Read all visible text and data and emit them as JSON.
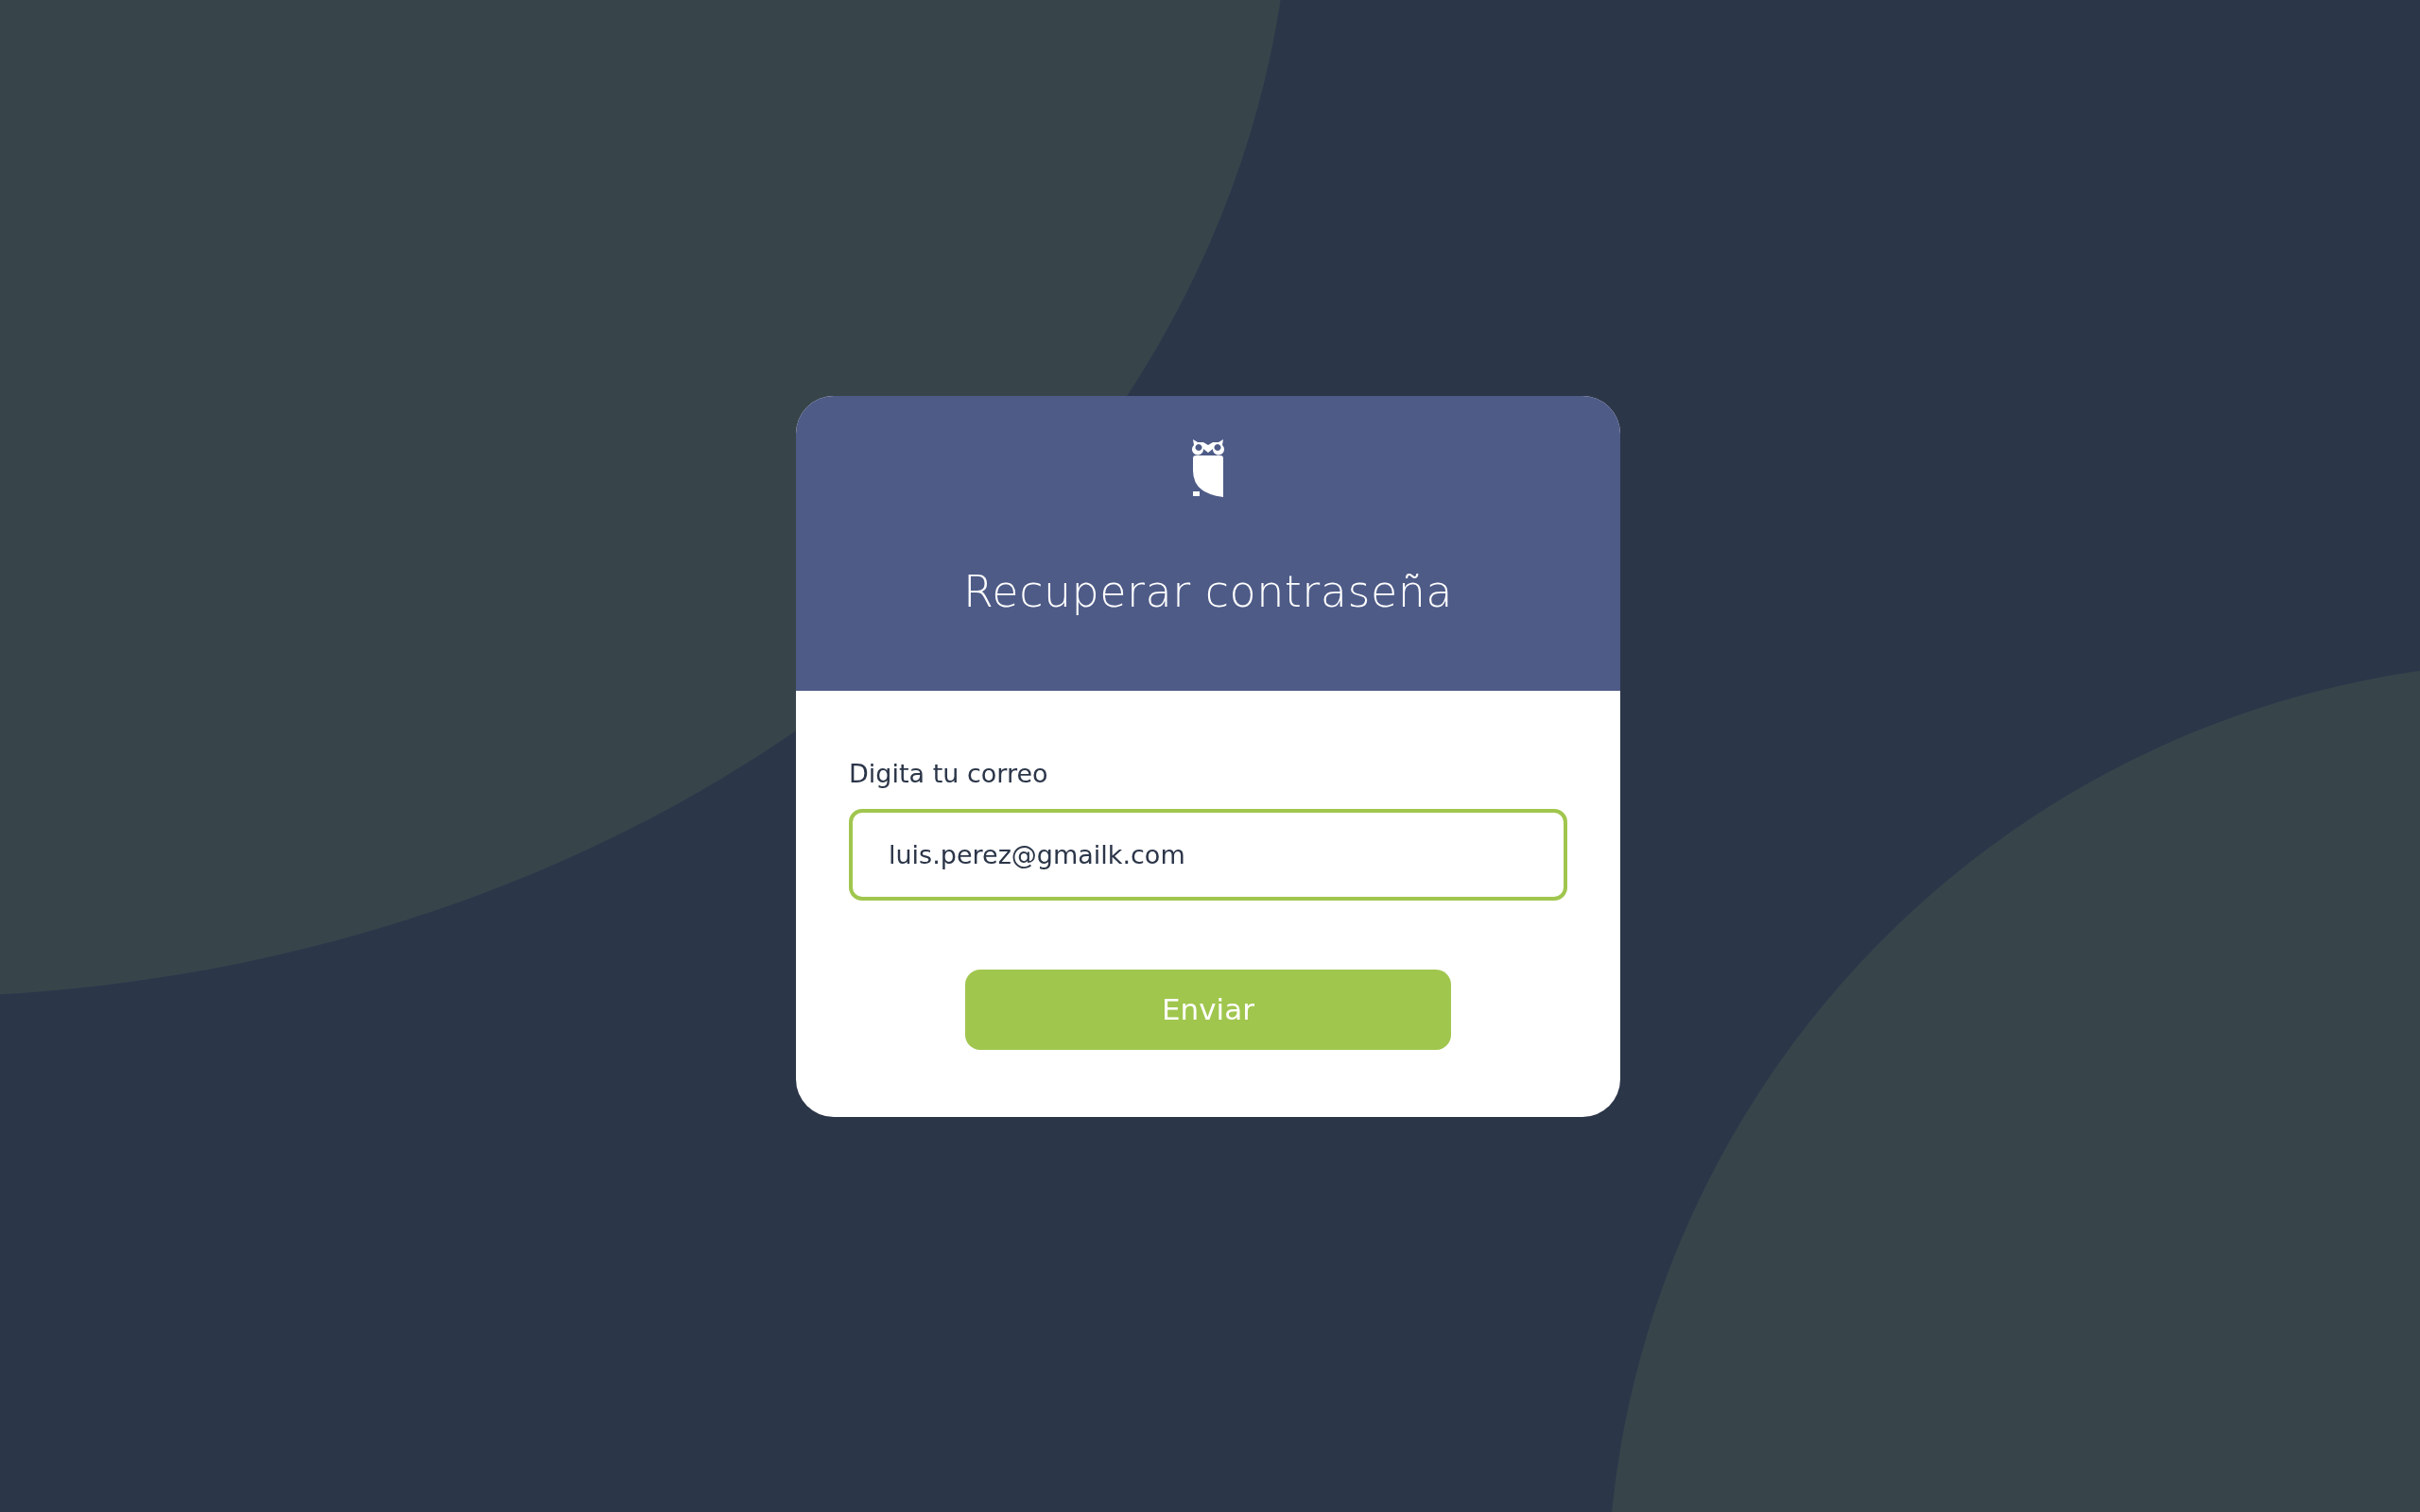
{
  "card": {
    "title": "Recuperar contraseña"
  },
  "form": {
    "label": "Digita tu correo",
    "email": {
      "value": "luis.perez@gmailk.com"
    },
    "submit": "Enviar"
  }
}
